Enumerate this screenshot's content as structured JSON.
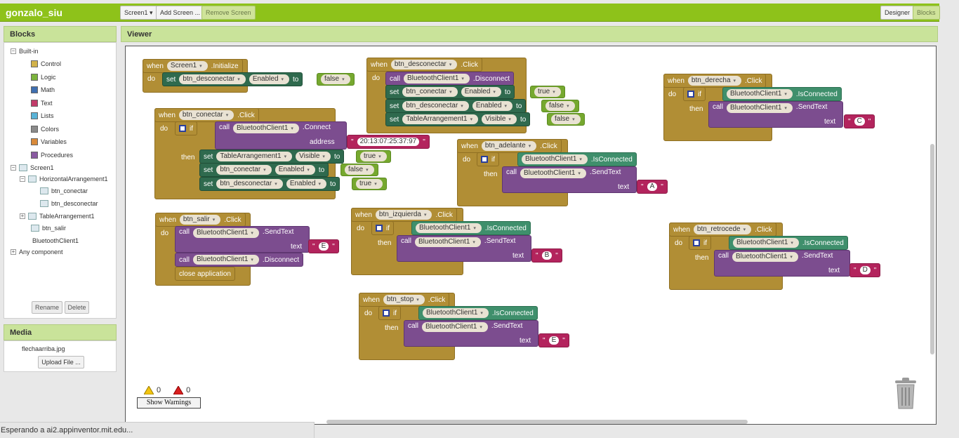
{
  "app": {
    "title": "gonzalo_siu"
  },
  "toolbar": {
    "screen_menu": "Screen1 ▾",
    "add_screen": "Add Screen ...",
    "remove_screen": "Remove Screen",
    "designer": "Designer",
    "blocks": "Blocks"
  },
  "blocks_panel": {
    "title": "Blocks",
    "builtin": "Built-in",
    "categories": [
      {
        "label": "Control",
        "color": "#d2b24a"
      },
      {
        "label": "Logic",
        "color": "#7cb33c"
      },
      {
        "label": "Math",
        "color": "#3f6fb0"
      },
      {
        "label": "Text",
        "color": "#c23b6a"
      },
      {
        "label": "Lists",
        "color": "#5ab3d7"
      },
      {
        "label": "Colors",
        "color": "#8a8a8a"
      },
      {
        "label": "Variables",
        "color": "#d98a3a"
      },
      {
        "label": "Procedures",
        "color": "#8a5aa1"
      }
    ],
    "screen": "Screen1",
    "components": [
      "HorizontalArrangement1",
      "btn_conectar",
      "btn_desconectar",
      "TableArrangement1",
      "btn_salir",
      "BluetoothClient1"
    ],
    "any_component": "Any component",
    "rename": "Rename",
    "delete": "Delete"
  },
  "media": {
    "title": "Media",
    "file": "flechaarriba.jpg",
    "upload": "Upload File ..."
  },
  "viewer": {
    "title": "Viewer",
    "warnings_count": "0",
    "errors_count": "0",
    "show_warnings": "Show Warnings"
  },
  "kw": {
    "when": "when",
    "do": "do",
    "set": "set",
    "to": "to",
    "call": "call",
    "if": "if",
    "then": "then",
    "text": "text",
    "address": "address",
    "close": "close application"
  },
  "blocks": {
    "init": {
      "comp": "Screen1",
      "event": ".Initialize",
      "c1": "btn_desconectar",
      "p1": "Enabled",
      "v1": "false"
    },
    "desc": {
      "comp": "btn_desconectar",
      "event": ".Click",
      "bt": "BluetoothClient1",
      "method": ".Disconnect",
      "c1": "btn_conectar",
      "p1": "Enabled",
      "v1": "true",
      "c2": "btn_desconectar",
      "p2": "Enabled",
      "v2": "false",
      "c3": "TableArrangement1",
      "p3": "Visible",
      "v3": "false"
    },
    "der": {
      "comp": "btn_derecha",
      "event": ".Click",
      "bt": "BluetoothClient1",
      "cond": ".IsConnected",
      "method": ".SendText",
      "val": "C"
    },
    "con": {
      "comp": "btn_conectar",
      "event": ".Click",
      "bt": "BluetoothClient1",
      "method": ".Connect",
      "addr": "20:13:07:25:37:97",
      "c1": "TableArrangement1",
      "p1": "Visible",
      "v1": "true",
      "c2": "btn_conectar",
      "p2": "Enabled",
      "v2": "false",
      "c3": "btn_desconectar",
      "p3": "Enabled",
      "v3": "true"
    },
    "ade": {
      "comp": "btn_adelante",
      "event": ".Click",
      "bt": "BluetoothClient1",
      "cond": ".IsConnected",
      "method": ".SendText",
      "val": "A"
    },
    "sal": {
      "comp": "btn_salir",
      "event": ".Click",
      "bt": "BluetoothClient1",
      "method": ".SendText",
      "val": "E",
      "method2": ".Disconnect"
    },
    "izq": {
      "comp": "btn_izquierda",
      "event": ".Click",
      "bt": "BluetoothClient1",
      "cond": ".IsConnected",
      "method": ".SendText",
      "val": "B"
    },
    "ret": {
      "comp": "btn_retrocede",
      "event": ".Click",
      "bt": "BluetoothClient1",
      "cond": ".IsConnected",
      "method": ".SendText",
      "val": "D"
    },
    "stop": {
      "comp": "btn_stop",
      "event": ".Click",
      "bt": "BluetoothClient1",
      "cond": ".IsConnected",
      "method": ".SendText",
      "val": "E"
    }
  },
  "status": {
    "text": "Esperando a ai2.appinventor.mit.edu..."
  }
}
